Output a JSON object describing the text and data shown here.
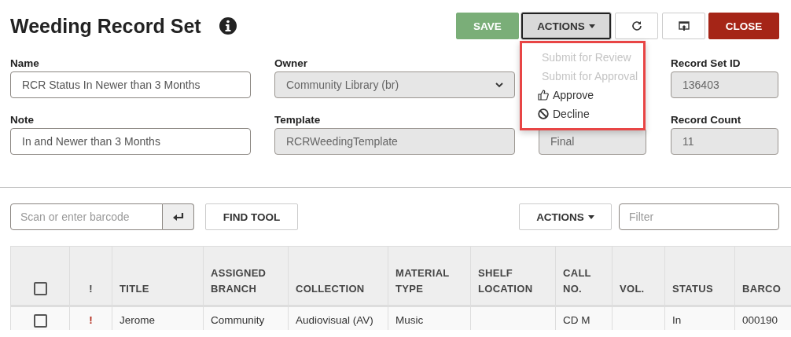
{
  "title": "Weeding Record Set",
  "buttons": {
    "save": "SAVE",
    "actions": "ACTIONS",
    "close": "CLOSE"
  },
  "actions_menu": [
    {
      "label": "Submit for Review",
      "disabled": true
    },
    {
      "label": "Submit for Approval",
      "disabled": true
    },
    {
      "label": "Approve",
      "disabled": false
    },
    {
      "label": "Decline",
      "disabled": false
    }
  ],
  "fields": [
    {
      "label": "Name",
      "value": "RCR Status In Newer than 3 Months",
      "kind": "text",
      "disabled": false
    },
    {
      "label": "Owner",
      "value": "Community Library (br)",
      "kind": "select",
      "disabled": true
    },
    {
      "kind": "blank"
    },
    {
      "label": "Record Set ID",
      "value": "136403",
      "kind": "text",
      "disabled": true
    },
    {
      "label": "Note",
      "value": "In and Newer than 3 Months",
      "kind": "text",
      "disabled": false
    },
    {
      "label": "Template",
      "value": "RCRWeedingTemplate",
      "kind": "text",
      "disabled": true
    },
    {
      "value": "Final",
      "kind": "text",
      "disabled": true
    },
    {
      "label": "Record Count",
      "value": "11",
      "kind": "text",
      "disabled": true
    }
  ],
  "barcode": {
    "placeholder": "Scan or enter barcode"
  },
  "find_tool": "FIND TOOL",
  "table_actions": "ACTIONS",
  "filter": {
    "placeholder": "Filter"
  },
  "table": {
    "select_all_checked": false,
    "flag_header": "!",
    "columns": [
      "TITLE",
      "ASSIGNED BRANCH",
      "COLLECTION",
      "MATERIAL TYPE",
      "SHELF LOCATION",
      "CALL NO.",
      "VOL.",
      "STATUS",
      "BARCO"
    ],
    "rows": [
      {
        "checked": false,
        "flag": "!",
        "cells": [
          "Jerome",
          "Community",
          "Audiovisual (AV)",
          "Music",
          "",
          "CD M",
          "",
          "In",
          "000190"
        ]
      }
    ]
  }
}
